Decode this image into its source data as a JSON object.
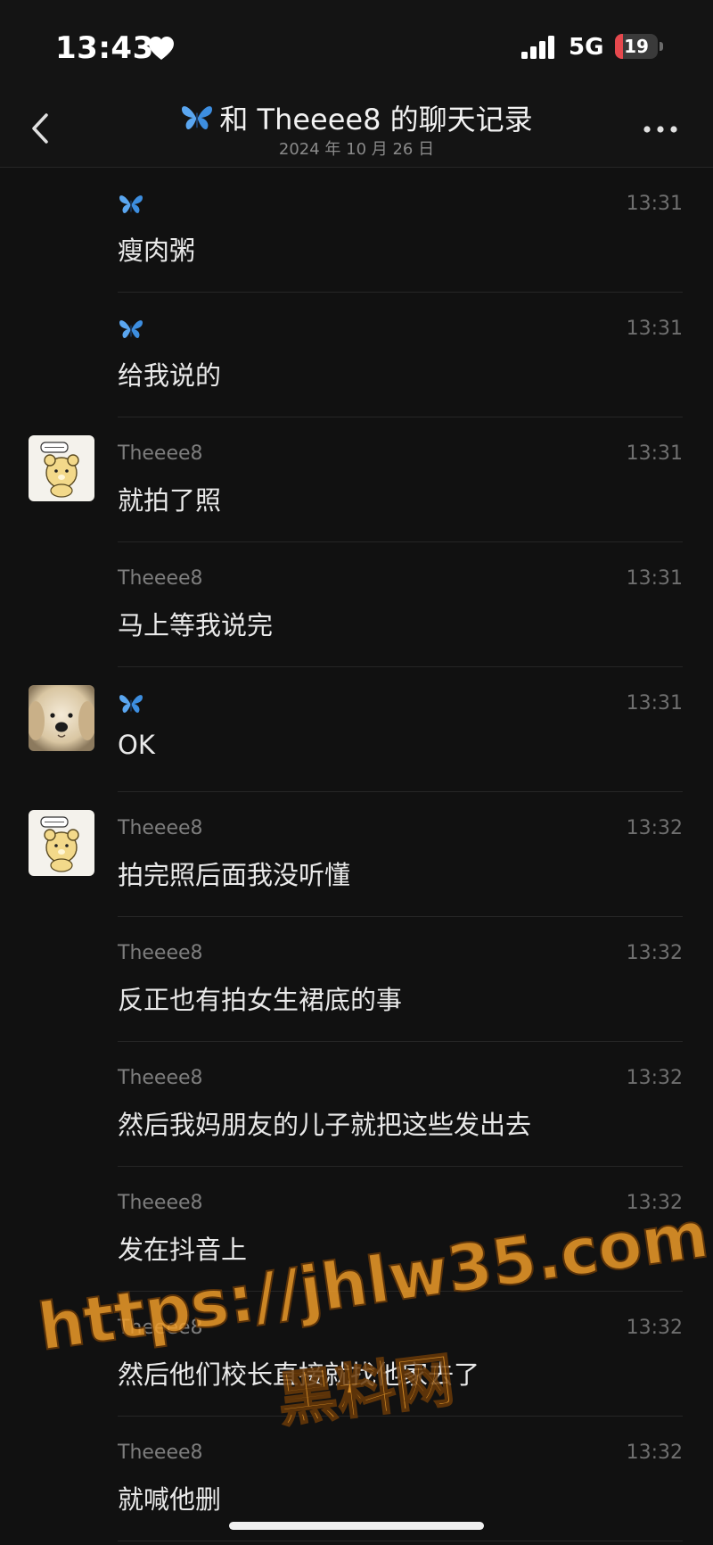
{
  "status_bar": {
    "time": "13:43",
    "network": "5G",
    "battery": "19",
    "battery_level": 0.19,
    "battery_color": "#e5484d"
  },
  "header": {
    "title_prefix": "和 Theeee8 的聊天记录",
    "date": "2024 年 10 月 26 日",
    "title_icon": "butterfly-icon"
  },
  "messages": [
    {
      "sender": "",
      "sender_icon": "butterfly-icon",
      "time": "13:31",
      "text": "瘦肉粥",
      "avatar": ""
    },
    {
      "sender": "",
      "sender_icon": "butterfly-icon",
      "time": "13:31",
      "text": "给我说的",
      "avatar": ""
    },
    {
      "sender": "Theeee8",
      "time": "13:31",
      "text": "就拍了照",
      "avatar": "bear-avatar"
    },
    {
      "sender": "Theeee8",
      "time": "13:31",
      "text": "马上等我说完",
      "avatar": ""
    },
    {
      "sender": "",
      "sender_icon": "butterfly-icon",
      "time": "13:31",
      "text": "OK",
      "avatar": "puppy-avatar"
    },
    {
      "sender": "Theeee8",
      "time": "13:32",
      "text": "拍完照后面我没听懂",
      "avatar": "bear-avatar"
    },
    {
      "sender": "Theeee8",
      "time": "13:32",
      "text": "反正也有拍女生裙底的事",
      "avatar": ""
    },
    {
      "sender": "Theeee8",
      "time": "13:32",
      "text": "然后我妈朋友的儿子就把这些发出去",
      "avatar": ""
    },
    {
      "sender": "Theeee8",
      "time": "13:32",
      "text": "发在抖音上",
      "avatar": ""
    },
    {
      "sender": "Theeee8",
      "time": "13:32",
      "text": "然后他们校长直接就找他家去了",
      "avatar": ""
    },
    {
      "sender": "Theeee8",
      "time": "13:32",
      "text": "就喊他删",
      "avatar": ""
    }
  ],
  "watermark": {
    "url": "https://jhlw35.com",
    "name": "黑料网",
    "color": "#f5a02a"
  }
}
